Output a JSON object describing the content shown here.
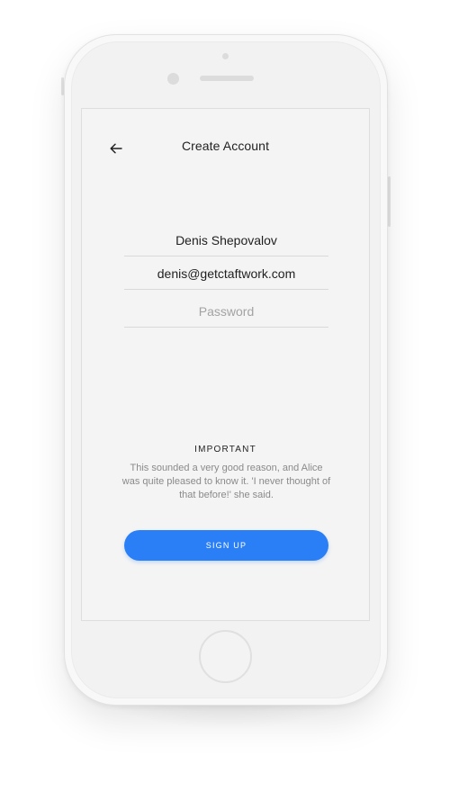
{
  "screen": {
    "title": "Create Account",
    "back_icon": "arrow-left-icon"
  },
  "form": {
    "name_value": "Denis Shepovalov",
    "email_value": "denis@getctaftwork.com",
    "password_placeholder": "Password"
  },
  "notice": {
    "heading": "IMPORTANT",
    "body": "This sounded a very good reason, and Alice was quite pleased to know it. 'I never thought of that before!' she said."
  },
  "actions": {
    "signup_label": "SIGN UP"
  },
  "colors": {
    "accent": "#2a7ff6",
    "screen_background": "#f4f4f4",
    "text_primary": "#1f1f1f",
    "text_muted": "#8a8a8a"
  }
}
